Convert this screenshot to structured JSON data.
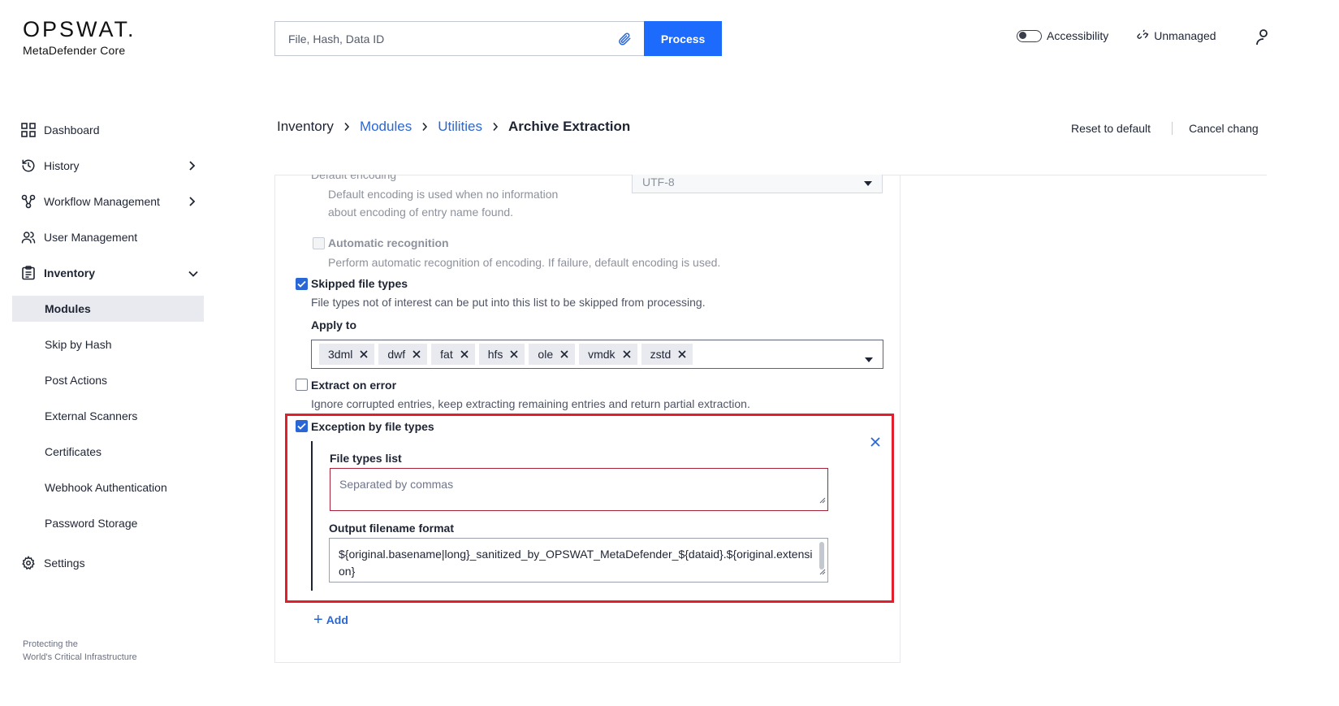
{
  "header": {
    "logo_word": "OPSWAT.",
    "logo_sub": "MetaDefender Core",
    "search_placeholder": "File, Hash, Data ID",
    "process_label": "Process",
    "accessibility_label": "Accessibility",
    "unmanaged_label": "Unmanaged"
  },
  "sidebar": {
    "items": [
      {
        "label": "Dashboard",
        "icon": "grid-icon"
      },
      {
        "label": "History",
        "icon": "history-icon"
      },
      {
        "label": "Workflow Management",
        "icon": "workflow-icon"
      },
      {
        "label": "User Management",
        "icon": "users-icon"
      },
      {
        "label": "Inventory",
        "icon": "clipboard-icon"
      }
    ],
    "inventory_sub": [
      "Modules",
      "Skip by Hash",
      "Post Actions",
      "External Scanners",
      "Certificates",
      "Webhook Authentication",
      "Password Storage"
    ],
    "settings_label": "Settings",
    "footer_line1": "Protecting the",
    "footer_line2": "World's Critical Infrastructure"
  },
  "breadcrumb": {
    "items": [
      "Inventory",
      "Modules",
      "Utilities",
      "Archive Extraction"
    ]
  },
  "actions": {
    "reset_label": "Reset to default",
    "cancel_label": "Cancel chang"
  },
  "content": {
    "default_encoding": {
      "title": "Default encoding",
      "desc_line1": "Default encoding is used when no information",
      "desc_line2": "about encoding of entry name found.",
      "value": "UTF-8"
    },
    "auto_recognition": {
      "title": "Automatic recognition",
      "desc": "Perform automatic recognition of encoding. If failure, default encoding is used.",
      "checked": false
    },
    "skipped_file_types": {
      "title": "Skipped file types",
      "desc": "File types not of interest can be put into this list to be skipped from processing.",
      "checked": true,
      "apply_to_label": "Apply to",
      "chips": [
        "3dml",
        "dwf",
        "fat",
        "hfs",
        "ole",
        "vmdk",
        "zstd"
      ]
    },
    "extract_on_error": {
      "title": "Extract on error",
      "desc": "Ignore corrupted entries, keep extracting remaining entries and return partial extraction.",
      "checked": false
    },
    "exception_by_file_types": {
      "title": "Exception by file types",
      "checked": true,
      "file_types_label": "File types list",
      "file_types_placeholder": "Separated by commas",
      "output_label": "Output filename format",
      "output_value_line1": "${original.basename|long}_sanitized_by_OPSWAT_MetaDefender_${dataid}.${original.extensi",
      "output_value_line2": "on}"
    },
    "add_label": "Add"
  },
  "colors": {
    "accent": "#1d6bfc",
    "link": "#2a67d6",
    "highlight": "#e21d2c"
  }
}
